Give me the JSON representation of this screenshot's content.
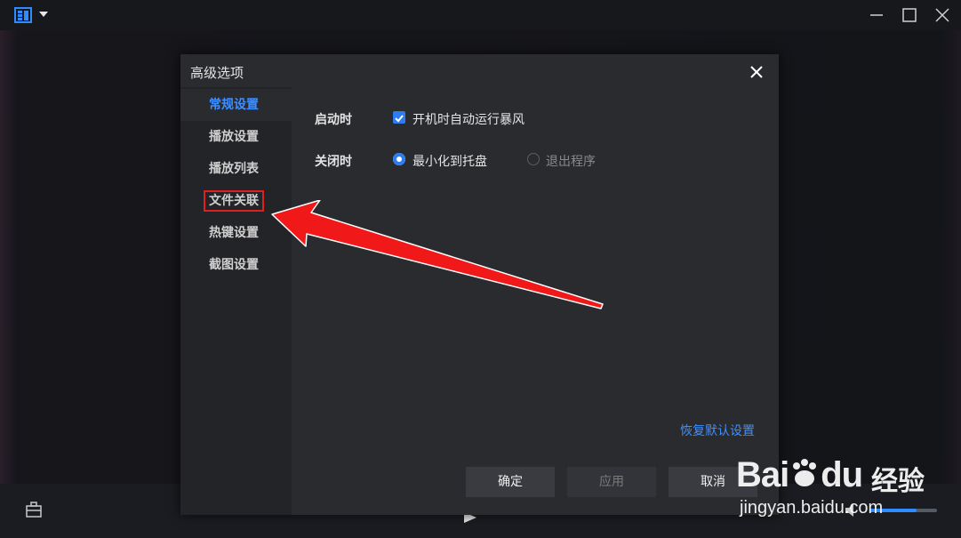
{
  "dialog": {
    "title": "高级选项",
    "nav": [
      {
        "label": "常规设置",
        "active": true
      },
      {
        "label": "播放设置"
      },
      {
        "label": "播放列表"
      },
      {
        "label": "文件关联",
        "highlighted": true
      },
      {
        "label": "热键设置"
      },
      {
        "label": "截图设置"
      }
    ],
    "startup": {
      "label": "启动时",
      "autorun_label": "开机时自动运行暴风",
      "autorun_checked": true
    },
    "close": {
      "label": "关闭时",
      "options": [
        {
          "label": "最小化到托盘",
          "selected": true
        },
        {
          "label": "退出程序",
          "selected": false
        }
      ]
    },
    "restore_defaults": "恢复默认设置",
    "buttons": {
      "ok": "确定",
      "apply": "应用",
      "cancel": "取消"
    }
  },
  "player": {
    "volume_fraction": 0.7
  },
  "watermark": {
    "brand": "Bai",
    "brand2": "du",
    "product": "经验",
    "url": "jingyan.baidu.com"
  },
  "colors": {
    "accent": "#3f8fff",
    "annotation": "#e02020"
  }
}
